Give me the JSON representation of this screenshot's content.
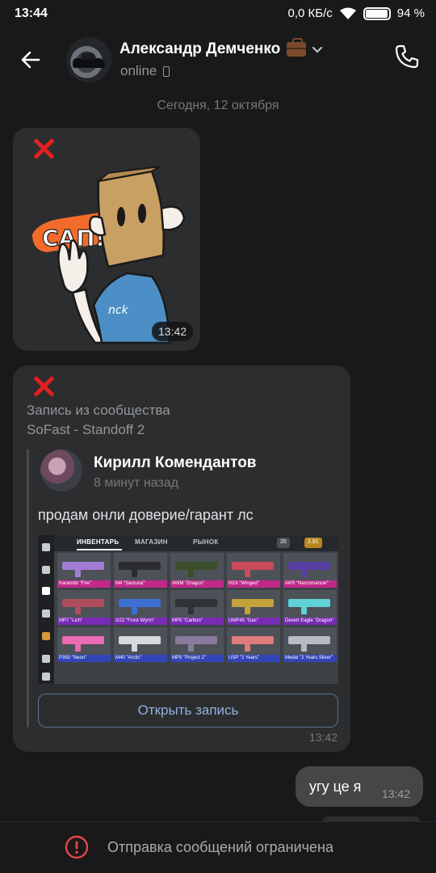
{
  "status_bar": {
    "time": "13:44",
    "network_speed": "0,0 КБ/с",
    "battery": "94 %"
  },
  "header": {
    "contact_name": "Александр Демченко",
    "status": "online"
  },
  "date_separator": "Сегодня, 12 октября",
  "sticker_message": {
    "sticker_text": "САП!",
    "time": "13:42"
  },
  "post_message": {
    "repost_label": "Запись из сообщества",
    "community_name": "SoFast - Standoff 2",
    "author_name": "Кирилл Комендантов",
    "post_time": "8 минут назад",
    "post_text": "продам онли доверие/гарант лс",
    "open_button": "Открыть запись",
    "time": "13:42",
    "screenshot": {
      "tab_inventory": "ИНВЕНТАРЬ",
      "tab_shop": "МАГАЗИН",
      "tab_market": "РЫНОК",
      "gold": "2.91",
      "silver": "20",
      "items": [
        {
          "label": "Karambit \"Fire\"",
          "color": "#c1288b",
          "gun": "#a37cd6"
        },
        {
          "label": "M4 \"Samurai\"",
          "color": "#c1288b",
          "gun": "#2c2c30"
        },
        {
          "label": "AWM \"Dragon\"",
          "color": "#c1288b",
          "gun": "#3a4f2a"
        },
        {
          "label": "M16 \"Winged\"",
          "color": "#c1288b",
          "gun": "#c94a5a"
        },
        {
          "label": "AKR \"Necromancer\"",
          "color": "#c1288b",
          "gun": "#5a3fa3"
        },
        {
          "label": "MP7 \"Lich\"",
          "color": "#7a2bb5",
          "gun": "#b04d5c"
        },
        {
          "label": "G22 \"Frost Wyrm\"",
          "color": "#7a2bb5",
          "gun": "#3c6fd1"
        },
        {
          "label": "MP5 \"Carbon\"",
          "color": "#7a2bb5",
          "gun": "#2f3236"
        },
        {
          "label": "UMP45 \"Gas\"",
          "color": "#7a2bb5",
          "gun": "#c4a23a"
        },
        {
          "label": "Desert Eagle \"Dragon\"",
          "color": "#7a2bb5",
          "gun": "#5fd2d6"
        },
        {
          "label": "P350 \"Neon\"",
          "color": "#3145b8",
          "gun": "#ea6ab4"
        },
        {
          "label": "M40 \"Arctic\"",
          "color": "#3145b8",
          "gun": "#d6d9dd"
        },
        {
          "label": "MP5 \"Project 2\"",
          "color": "#3145b8",
          "gun": "#8a7a9c"
        },
        {
          "label": "USP \"2 Years\"",
          "color": "#3145b8",
          "gun": "#e07b7b"
        },
        {
          "label": "Medal \"2 Years Silver\"",
          "color": "#3145b8",
          "gun": "#b7bcc2"
        }
      ]
    }
  },
  "outgoing_message": {
    "text": "угу це я",
    "time": "13:42"
  },
  "bottom_bar": {
    "restriction_text": "Отправка сообщений ограничена"
  },
  "colors": {
    "background": "#19191a",
    "bubble_incoming": "#2c2d2e",
    "bubble_outgoing": "#454647",
    "accent_link": "#8fb3e0",
    "warning": "#e64646",
    "red_x": "#e32020"
  }
}
